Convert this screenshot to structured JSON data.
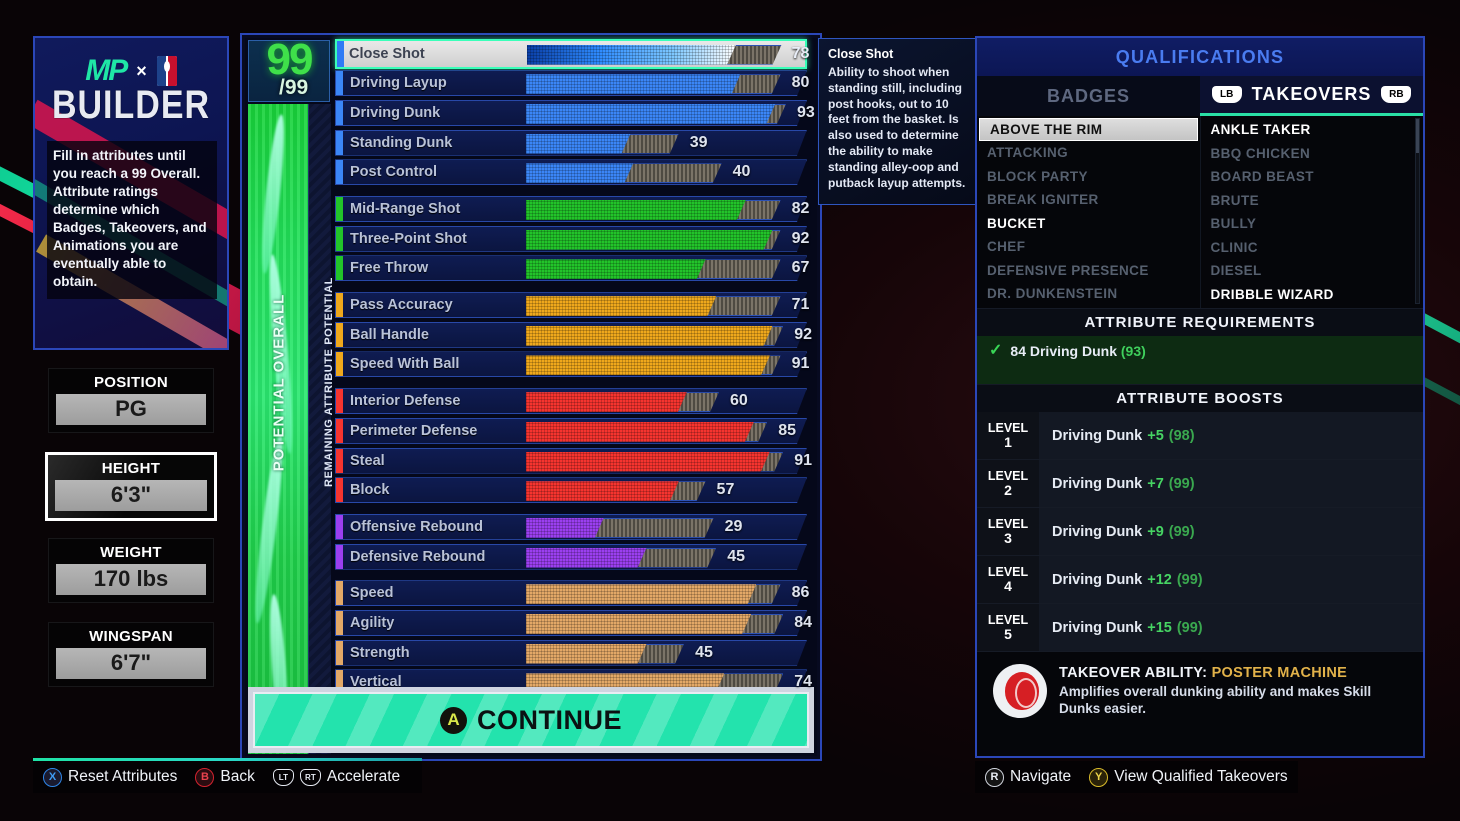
{
  "left_panel": {
    "logo_mp": "MP",
    "logo_x": "×",
    "logo_builder": "BUILDER",
    "description": "Fill in attributes until you reach a 99 Overall. Attribute ratings determine which Badges, Takeovers, and Animations you are eventually able to obtain.",
    "stats": [
      {
        "label": "POSITION",
        "value": "PG",
        "selected": false
      },
      {
        "label": "HEIGHT",
        "value": "6'3\"",
        "selected": true
      },
      {
        "label": "WEIGHT",
        "value": "170 lbs",
        "selected": false
      },
      {
        "label": "WINGSPAN",
        "value": "6'7\"",
        "selected": false
      }
    ]
  },
  "center_panel": {
    "overall_current": "99",
    "overall_max": "/99",
    "potential_overall_label": "POTENTIAL OVERALL",
    "remaining_potential_label": "REMAINING ATTRIBUTE POTENTIAL",
    "continue_label": "CONTINUE",
    "continue_button_glyph": "A",
    "attributes": [
      {
        "name": "Close Shot",
        "value": 78,
        "potential": 95,
        "color": "#2f7bf5",
        "group": "finishing",
        "selected": true
      },
      {
        "name": "Driving Layup",
        "value": 80,
        "potential": 95,
        "color": "#3b86f7",
        "group": "finishing",
        "selected": false
      },
      {
        "name": "Driving Dunk",
        "value": 93,
        "potential": 97,
        "color": "#3b86f7",
        "group": "finishing",
        "selected": false
      },
      {
        "name": "Standing Dunk",
        "value": 39,
        "potential": 57,
        "color": "#3b86f7",
        "group": "finishing",
        "selected": false
      },
      {
        "name": "Post Control",
        "value": 40,
        "potential": 73,
        "color": "#3b86f7",
        "group": "finishing",
        "selected": false
      },
      {
        "name": "Mid-Range Shot",
        "value": 82,
        "potential": 95,
        "color": "#22c42a",
        "group": "shooting",
        "selected": false
      },
      {
        "name": "Three-Point Shot",
        "value": 92,
        "potential": 95,
        "color": "#22c42a",
        "group": "shooting",
        "selected": false
      },
      {
        "name": "Free Throw",
        "value": 67,
        "potential": 95,
        "color": "#22c42a",
        "group": "shooting",
        "selected": false
      },
      {
        "name": "Pass Accuracy",
        "value": 71,
        "potential": 95,
        "color": "#efa81c",
        "group": "playmaking",
        "selected": false
      },
      {
        "name": "Ball Handle",
        "value": 92,
        "potential": 96,
        "color": "#efa81c",
        "group": "playmaking",
        "selected": false
      },
      {
        "name": "Speed With Ball",
        "value": 91,
        "potential": 95,
        "color": "#efa81c",
        "group": "playmaking",
        "selected": false
      },
      {
        "name": "Interior Defense",
        "value": 60,
        "potential": 72,
        "color": "#f6342f",
        "group": "defense",
        "selected": false
      },
      {
        "name": "Perimeter Defense",
        "value": 85,
        "potential": 90,
        "color": "#f6342f",
        "group": "defense",
        "selected": false
      },
      {
        "name": "Steal",
        "value": 91,
        "potential": 96,
        "color": "#f6342f",
        "group": "defense",
        "selected": false
      },
      {
        "name": "Block",
        "value": 57,
        "potential": 67,
        "color": "#f6342f",
        "group": "defense",
        "selected": false
      },
      {
        "name": "Offensive Rebound",
        "value": 29,
        "potential": 70,
        "color": "#9b3ff0",
        "group": "rebound",
        "selected": false
      },
      {
        "name": "Defensive Rebound",
        "value": 45,
        "potential": 71,
        "color": "#9b3ff0",
        "group": "rebound",
        "selected": false
      },
      {
        "name": "Speed",
        "value": 86,
        "potential": 95,
        "color": "#e3a867",
        "group": "physical",
        "selected": false
      },
      {
        "name": "Agility",
        "value": 84,
        "potential": 96,
        "color": "#e3a867",
        "group": "physical",
        "selected": false
      },
      {
        "name": "Strength",
        "value": 45,
        "potential": 59,
        "color": "#e3a867",
        "group": "physical",
        "selected": false
      },
      {
        "name": "Vertical",
        "value": 74,
        "potential": 96,
        "color": "#e3a867",
        "group": "physical",
        "selected": false
      }
    ]
  },
  "tooltip": {
    "title": "Close Shot",
    "body": "Ability to shoot when standing still, including post hooks, out to 10 feet from the basket. Is also used to determine the ability to make standing alley-oop and putback layup attempts."
  },
  "right_panel": {
    "title": "QUALIFICATIONS",
    "tabs": {
      "badges": "BADGES",
      "takeovers": "TAKEOVERS",
      "lb": "LB",
      "rb": "RB"
    },
    "badges": [
      {
        "label": "ABOVE THE RIM",
        "state": "highlight"
      },
      {
        "label": "ATTACKING",
        "state": "dim"
      },
      {
        "label": "BLOCK PARTY",
        "state": "dim"
      },
      {
        "label": "BREAK IGNITER",
        "state": "dim"
      },
      {
        "label": "BUCKET",
        "state": "qualified"
      },
      {
        "label": "CHEF",
        "state": "dim"
      },
      {
        "label": "DEFENSIVE PRESENCE",
        "state": "dim"
      },
      {
        "label": "DR. DUNKENSTEIN",
        "state": "dim"
      }
    ],
    "takeovers": [
      {
        "label": "ANKLE TAKER",
        "state": "qualified"
      },
      {
        "label": "BBQ CHICKEN",
        "state": "dim"
      },
      {
        "label": "BOARD BEAST",
        "state": "dim"
      },
      {
        "label": "BRUTE",
        "state": "dim"
      },
      {
        "label": "BULLY",
        "state": "dim"
      },
      {
        "label": "CLINIC",
        "state": "dim"
      },
      {
        "label": "DIESEL",
        "state": "dim"
      },
      {
        "label": "DRIBBLE WIZARD",
        "state": "qualified"
      }
    ],
    "requirements_heading": "ATTRIBUTE REQUIREMENTS",
    "requirement": {
      "check": "✓",
      "text": "84 Driving Dunk",
      "current": "(93)"
    },
    "boosts_heading": "ATTRIBUTE BOOSTS",
    "boosts": [
      {
        "level_word": "LEVEL",
        "level_num": "1",
        "attribute": "Driving Dunk",
        "delta": "+5",
        "result": "(98)"
      },
      {
        "level_word": "LEVEL",
        "level_num": "2",
        "attribute": "Driving Dunk",
        "delta": "+7",
        "result": "(99)"
      },
      {
        "level_word": "LEVEL",
        "level_num": "3",
        "attribute": "Driving Dunk",
        "delta": "+9",
        "result": "(99)"
      },
      {
        "level_word": "LEVEL",
        "level_num": "4",
        "attribute": "Driving Dunk",
        "delta": "+12",
        "result": "(99)"
      },
      {
        "level_word": "LEVEL",
        "level_num": "5",
        "attribute": "Driving Dunk",
        "delta": "+15",
        "result": "(99)"
      }
    ],
    "takeover_ability": {
      "prefix": "TAKEOVER ABILITY:",
      "name": "POSTER MACHINE",
      "description": "Amplifies overall dunking ability and makes Skill Dunks easier."
    }
  },
  "footer_left": [
    {
      "glyph": "X",
      "kind": "x",
      "label": "Reset Attributes"
    },
    {
      "glyph": "B",
      "kind": "b",
      "label": "Back"
    },
    {
      "glyph": "LT",
      "kind": "trigger",
      "glyph2": "RT",
      "label": "Accelerate"
    }
  ],
  "footer_right": [
    {
      "glyph": "R",
      "kind": "r",
      "label": "Navigate"
    },
    {
      "glyph": "Y",
      "kind": "y",
      "label": "View Qualified Takeovers"
    }
  ],
  "colors": {
    "accent_green": "#2ae0a6",
    "panel_border": "#2b47b8",
    "qual_title": "#4a7cf0",
    "takeover_name": "#e2b24a"
  }
}
